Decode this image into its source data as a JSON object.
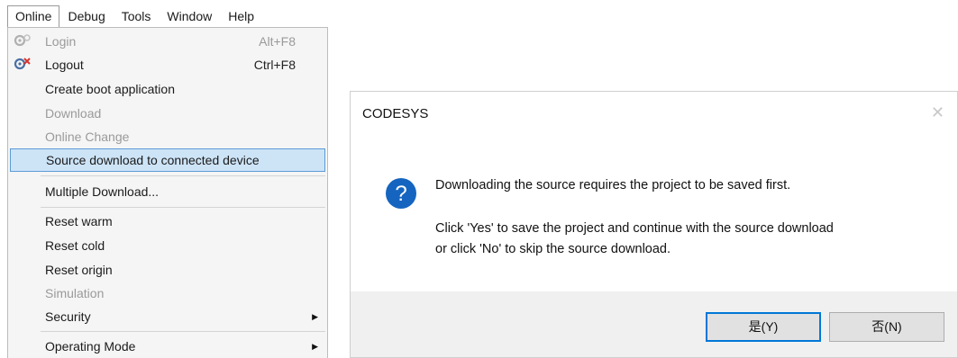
{
  "menubar": {
    "items": [
      "Online",
      "Debug",
      "Tools",
      "Window",
      "Help"
    ]
  },
  "menu": {
    "items": [
      {
        "label": "Login",
        "shortcut": "Alt+F8",
        "disabled": true,
        "icon": "login-icon"
      },
      {
        "label": "Logout",
        "shortcut": "Ctrl+F8",
        "disabled": false,
        "icon": "logout-icon"
      },
      {
        "label": "Create boot application",
        "disabled": false
      },
      {
        "label": "Download",
        "disabled": true
      },
      {
        "label": "Online Change",
        "disabled": true
      },
      {
        "label": "Source download to connected device",
        "disabled": false,
        "highlighted": true
      },
      {
        "label": "Multiple Download...",
        "disabled": false
      },
      {
        "label": "Reset warm",
        "disabled": false
      },
      {
        "label": "Reset cold",
        "disabled": false
      },
      {
        "label": "Reset origin",
        "disabled": false
      },
      {
        "label": "Simulation",
        "disabled": true
      },
      {
        "label": "Security",
        "disabled": false,
        "submenu": true
      },
      {
        "label": "Operating Mode",
        "disabled": false,
        "submenu": true
      }
    ]
  },
  "dialog": {
    "title": "CODESYS",
    "icon": "question-icon",
    "message_line1": "Downloading the source requires the project to be saved first.",
    "message_line2": "Click 'Yes' to save the project and continue with the source download",
    "message_line3": "or click 'No' to skip the source download.",
    "yes_label": "是(Y)",
    "no_label": "否(N)",
    "accent_color": "#0078d7",
    "icon_color": "#1565c0"
  }
}
